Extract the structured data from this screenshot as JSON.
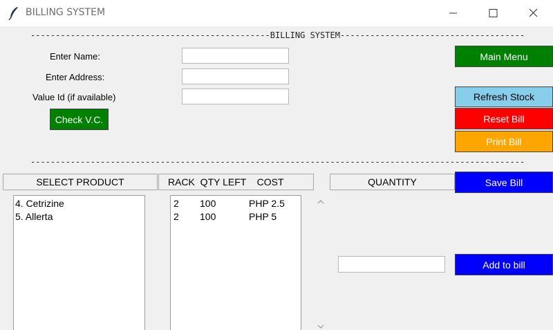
{
  "window": {
    "title": "BILLING SYSTEM"
  },
  "divider_top": "------------------------------------------------BILLING SYSTEM-----------------------------------------------",
  "divider_mid": "-------------------------------------------------------------------------------------------------------------",
  "form": {
    "name_label": "Enter Name:",
    "name_value": "",
    "address_label": "Enter Address:",
    "address_value": "",
    "value_id_label": "Value Id (if available)",
    "value_id_value": "",
    "check_vc_label": "Check V.C."
  },
  "side_buttons": {
    "main_menu": "Main Menu",
    "refresh_stock": "Refresh Stock",
    "reset_bill": "Reset Bill",
    "print_bill": "Print Bill",
    "save_bill": "Save Bill",
    "add_to_bill": "Add to bill"
  },
  "headers": {
    "select_product": "SELECT PRODUCT",
    "rack_qty_cost": "RACK  QTY LEFT    COST",
    "quantity": "QUANTITY"
  },
  "products": [
    "4. Cetrizine",
    "5. Allerta"
  ],
  "stock": [
    {
      "rack": "2",
      "qty_left": "100",
      "cost": "PHP 2.5"
    },
    {
      "rack": "2",
      "qty_left": "100",
      "cost": "PHP 5"
    }
  ],
  "quantity_value": "",
  "colors": {
    "green": "#008000",
    "light_blue": "#87ceeb",
    "red": "#ff0000",
    "orange": "#ffa500",
    "blue": "#0000ff"
  }
}
